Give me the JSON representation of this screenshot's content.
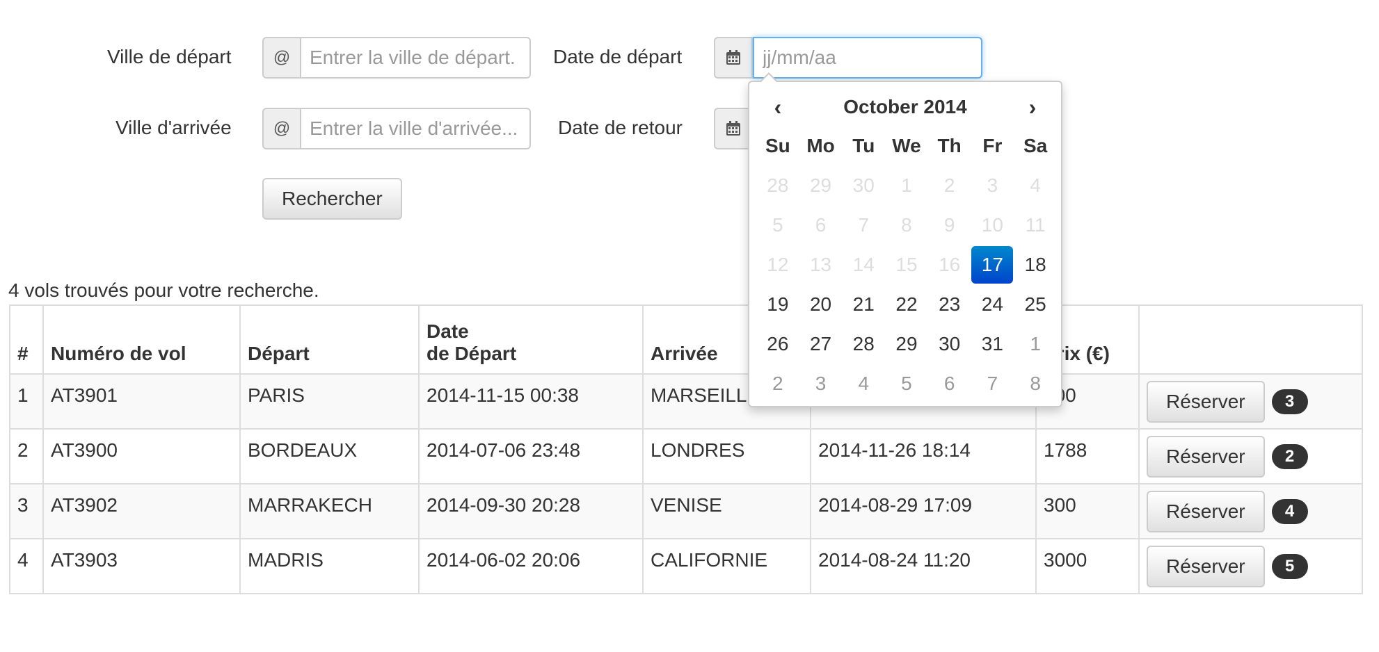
{
  "form": {
    "ville_depart_label": "Ville de départ",
    "ville_depart_addon": "@",
    "ville_depart_placeholder": "Entrer la ville de départ.",
    "date_depart_label": "Date de départ",
    "date_depart_placeholder": "jj/mm/aa",
    "ville_arrivee_label": "Ville d'arrivée",
    "ville_arrivee_addon": "@",
    "ville_arrivee_placeholder": "Entrer la ville d'arrivée...",
    "date_retour_label": "Date de retour",
    "search_button": "Rechercher",
    "calendar_icon": "calendar-icon"
  },
  "results": {
    "summary": "4 vols trouvés pour votre recherche.",
    "headers": {
      "num": "#",
      "flight": "Numéro de vol",
      "depart": "Départ",
      "date_depart_1": "Date",
      "date_depart_2": "de Départ",
      "arrivee": "Arrivée",
      "date_arrivee": "",
      "prix": "Prix (€)"
    },
    "reserve_label": "Réserver",
    "rows": [
      {
        "num": "1",
        "flight": "AT3901",
        "depart": "PARIS",
        "date_depart": "2014-11-15 00:38",
        "arrivee": "MARSEILLE",
        "date_arrivee": "",
        "prix": "500",
        "badge": "3"
      },
      {
        "num": "2",
        "flight": "AT3900",
        "depart": "BORDEAUX",
        "date_depart": "2014-07-06 23:48",
        "arrivee": "LONDRES",
        "date_arrivee": "2014-11-26 18:14",
        "prix": "1788",
        "badge": "2"
      },
      {
        "num": "3",
        "flight": "AT3902",
        "depart": "MARRAKECH",
        "date_depart": "2014-09-30 20:28",
        "arrivee": "VENISE",
        "date_arrivee": "2014-08-29 17:09",
        "prix": "300",
        "badge": "4"
      },
      {
        "num": "4",
        "flight": "AT3903",
        "depart": "MADRIS",
        "date_depart": "2014-06-02 20:06",
        "arrivee": "CALIFORNIE",
        "date_arrivee": "2014-08-24 11:20",
        "prix": "3000",
        "badge": "5"
      }
    ]
  },
  "datepicker": {
    "prev": "‹",
    "next": "›",
    "title": "October 2014",
    "weekdays": [
      "Su",
      "Mo",
      "Tu",
      "We",
      "Th",
      "Fr",
      "Sa"
    ],
    "weeks": [
      [
        {
          "d": "28",
          "s": "dis"
        },
        {
          "d": "29",
          "s": "dis"
        },
        {
          "d": "30",
          "s": "dis"
        },
        {
          "d": "1",
          "s": "dis"
        },
        {
          "d": "2",
          "s": "dis"
        },
        {
          "d": "3",
          "s": "dis"
        },
        {
          "d": "4",
          "s": "dis"
        }
      ],
      [
        {
          "d": "5",
          "s": "dis"
        },
        {
          "d": "6",
          "s": "dis"
        },
        {
          "d": "7",
          "s": "dis"
        },
        {
          "d": "8",
          "s": "dis"
        },
        {
          "d": "9",
          "s": "dis"
        },
        {
          "d": "10",
          "s": "dis"
        },
        {
          "d": "11",
          "s": "dis"
        }
      ],
      [
        {
          "d": "12",
          "s": "dis"
        },
        {
          "d": "13",
          "s": "dis"
        },
        {
          "d": "14",
          "s": "dis"
        },
        {
          "d": "15",
          "s": "dis"
        },
        {
          "d": "16",
          "s": "dis"
        },
        {
          "d": "17",
          "s": "act"
        },
        {
          "d": "18",
          "s": ""
        }
      ],
      [
        {
          "d": "19",
          "s": ""
        },
        {
          "d": "20",
          "s": ""
        },
        {
          "d": "21",
          "s": ""
        },
        {
          "d": "22",
          "s": ""
        },
        {
          "d": "23",
          "s": ""
        },
        {
          "d": "24",
          "s": ""
        },
        {
          "d": "25",
          "s": ""
        }
      ],
      [
        {
          "d": "26",
          "s": ""
        },
        {
          "d": "27",
          "s": ""
        },
        {
          "d": "28",
          "s": ""
        },
        {
          "d": "29",
          "s": ""
        },
        {
          "d": "30",
          "s": ""
        },
        {
          "d": "31",
          "s": ""
        },
        {
          "d": "1",
          "s": "oth"
        }
      ],
      [
        {
          "d": "2",
          "s": "oth"
        },
        {
          "d": "3",
          "s": "oth"
        },
        {
          "d": "4",
          "s": "oth"
        },
        {
          "d": "5",
          "s": "oth"
        },
        {
          "d": "6",
          "s": "oth"
        },
        {
          "d": "7",
          "s": "oth"
        },
        {
          "d": "8",
          "s": "oth"
        }
      ]
    ]
  },
  "colors": {
    "focus_border": "#66afe9",
    "active_day": "#0044cc",
    "badge_bg": "#333333"
  }
}
